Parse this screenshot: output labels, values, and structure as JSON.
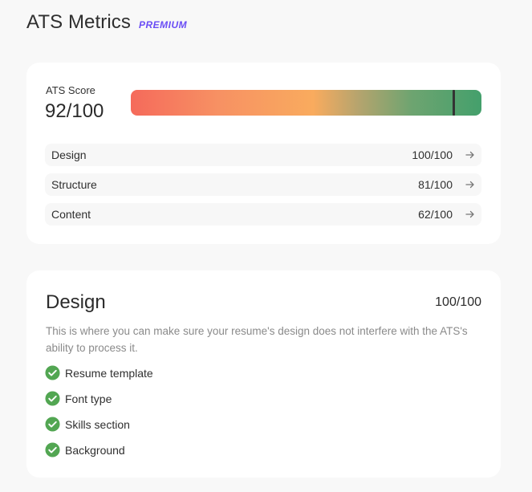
{
  "header": {
    "title": "ATS Metrics",
    "badge": "PREMIUM"
  },
  "score_card": {
    "label": "ATS Score",
    "value": "92/100",
    "score_fraction": 0.92,
    "rows": [
      {
        "name": "Design",
        "value": "100/100",
        "icon": "arrow-right-icon"
      },
      {
        "name": "Structure",
        "value": "81/100",
        "icon": "arrow-right-icon"
      },
      {
        "name": "Content",
        "value": "62/100",
        "icon": "arrow-right-icon"
      }
    ]
  },
  "design_card": {
    "title": "Design",
    "score": "100/100",
    "description": "This is where you can make sure your resume's design does not interfere with the ATS's ability to process it.",
    "checks": [
      {
        "label": "Resume template",
        "icon": "check-circle-icon"
      },
      {
        "label": "Font type",
        "icon": "check-circle-icon"
      },
      {
        "label": "Skills section",
        "icon": "check-circle-icon"
      },
      {
        "label": "Background",
        "icon": "check-circle-icon"
      }
    ]
  },
  "colors": {
    "accent": "#6a4df5",
    "check": "#52a652",
    "text": "#2b2b2b",
    "muted": "#8a8a8a"
  }
}
